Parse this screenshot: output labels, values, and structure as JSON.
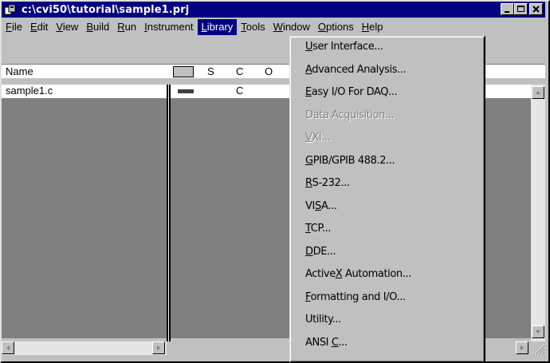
{
  "window": {
    "title": "c:\\cvi50\\tutorial\\sample1.prj"
  },
  "menubar": {
    "items": [
      {
        "label": "File",
        "u": "F",
        "rest": "ile"
      },
      {
        "label": "Edit",
        "u": "E",
        "rest": "dit"
      },
      {
        "label": "View",
        "u": "V",
        "rest": "iew"
      },
      {
        "label": "Build",
        "u": "B",
        "rest": "uild"
      },
      {
        "label": "Run",
        "u": "R",
        "rest": "un"
      },
      {
        "label": "Instrument",
        "u": "I",
        "rest": "nstrument"
      },
      {
        "label": "Library",
        "u": "L",
        "rest": "ibrary"
      },
      {
        "label": "Tools",
        "u": "T",
        "rest": "ools"
      },
      {
        "label": "Window",
        "u": "W",
        "rest": "indow"
      },
      {
        "label": "Options",
        "u": "O",
        "rest": "ptions"
      },
      {
        "label": "Help",
        "u": "H",
        "rest": "elp"
      }
    ],
    "active": "Library"
  },
  "project_list": {
    "header": {
      "name": "Name",
      "s": "S",
      "c": "C",
      "o": "O"
    },
    "rows": [
      {
        "name": "sample1.c",
        "c": "C"
      }
    ]
  },
  "library_menu": {
    "items": [
      {
        "pre": "",
        "u": "U",
        "post": "ser Interface...",
        "enabled": true
      },
      {
        "pre": "",
        "u": "A",
        "post": "dvanced Analysis...",
        "enabled": true
      },
      {
        "pre": "",
        "u": "E",
        "post": "asy I/O For DAQ...",
        "enabled": true
      },
      {
        "pre": "Data Acquisition...",
        "u": "",
        "post": "",
        "enabled": false
      },
      {
        "pre": "",
        "u": "V",
        "post": "XI...",
        "enabled": false
      },
      {
        "pre": "",
        "u": "G",
        "post": "PIB/GPIB 488.2...",
        "enabled": true
      },
      {
        "pre": "",
        "u": "R",
        "post": "S-232...",
        "enabled": true
      },
      {
        "pre": "VI",
        "u": "S",
        "post": "A...",
        "enabled": true
      },
      {
        "pre": "",
        "u": "T",
        "post": "CP...",
        "enabled": true
      },
      {
        "pre": "",
        "u": "D",
        "post": "DE...",
        "enabled": true
      },
      {
        "pre": "Active",
        "u": "X",
        "post": " Automation...",
        "enabled": true
      },
      {
        "pre": "",
        "u": "F",
        "post": "ormatting and I/O...",
        "enabled": true
      },
      {
        "pre": "Utilit",
        "u": "y",
        "post": "...",
        "enabled": true
      },
      {
        "pre": "ANSI ",
        "u": "C",
        "post": "...",
        "enabled": true
      }
    ]
  }
}
